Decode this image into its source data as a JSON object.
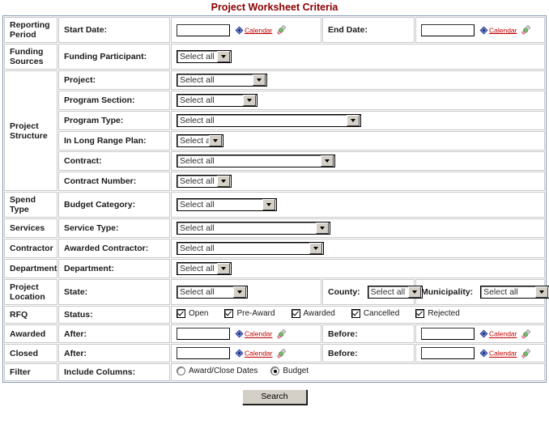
{
  "page": {
    "title": "Project Worksheet Criteria",
    "title_color": "#8b0000",
    "group_header_color": "#8da5c4"
  },
  "icons": {
    "calendar": "calendar-icon",
    "eraser": "eraser-icon"
  },
  "common": {
    "select_all": "Select all",
    "calendar_link": "Calendar"
  },
  "rows": {
    "reporting_period": {
      "group": "Reporting Period",
      "start_label": "Start Date:",
      "start_value": "",
      "end_label": "End Date:",
      "end_value": "",
      "calendar_link": "Calendar"
    },
    "funding_sources": {
      "group": "Funding Sources",
      "label": "Funding Participant:",
      "value": "Select all"
    },
    "project_structure": {
      "group": "Project Structure",
      "fields": [
        {
          "label": "Project:",
          "value": "Select all"
        },
        {
          "label": "Program Section:",
          "value": "Select all"
        },
        {
          "label": "Program Type:",
          "value": "Select all"
        },
        {
          "label": "In Long Range Plan:",
          "value": "Select all"
        },
        {
          "label": "Contract:",
          "value": "Select all"
        },
        {
          "label": "Contract Number:",
          "value": "Select all"
        }
      ]
    },
    "spend_type": {
      "group": "Spend Type",
      "label": "Budget Category:",
      "value": "Select all"
    },
    "services": {
      "group": "Services",
      "label": "Service Type:",
      "value": "Select all"
    },
    "contractor": {
      "group": "Contractor",
      "label": "Awarded Contractor:",
      "value": "Select all"
    },
    "department": {
      "group": "Department",
      "label": "Department:",
      "value": "Select all"
    },
    "project_location": {
      "group": "Project Location",
      "state_label": "State:",
      "state_value": "Select all",
      "county_label": "County:",
      "county_value": "Select all",
      "municipality_label": "Municipality:",
      "municipality_value": "Select all"
    },
    "rfq": {
      "group": "RFQ",
      "label": "Status:",
      "statuses": [
        {
          "label": "Open",
          "checked": true
        },
        {
          "label": "Pre-Award",
          "checked": true
        },
        {
          "label": "Awarded",
          "checked": true
        },
        {
          "label": "Cancelled",
          "checked": true
        },
        {
          "label": "Rejected",
          "checked": true
        }
      ]
    },
    "awarded": {
      "group": "Awarded",
      "after_label": "After:",
      "after_value": "",
      "before_label": "Before:",
      "before_value": "",
      "calendar_link": "Calendar"
    },
    "closed": {
      "group": "Closed",
      "after_label": "After:",
      "after_value": "",
      "before_label": "Before:",
      "before_value": "",
      "calendar_link": "Calendar"
    },
    "filter": {
      "group": "Filter",
      "label": "Include Columns:",
      "options": [
        {
          "label": "Award/Close Dates",
          "checked": false
        },
        {
          "label": "Budget",
          "checked": true
        }
      ]
    }
  },
  "actions": {
    "search": "Search"
  }
}
